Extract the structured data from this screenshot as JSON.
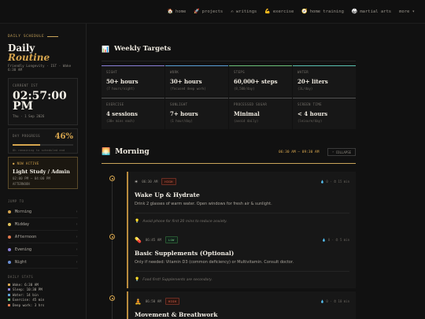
{
  "nav": {
    "items": [
      {
        "icon": "🏠",
        "icon_name": "home-icon",
        "label": "home"
      },
      {
        "icon": "🚀",
        "icon_name": "rocket-icon",
        "label": "projects"
      },
      {
        "icon": "✍",
        "icon_name": "writing-icon",
        "label": "writings"
      },
      {
        "icon": "💪",
        "icon_name": "muscle-icon",
        "label": "exercise"
      },
      {
        "icon": "🧭",
        "icon_name": "compass-icon",
        "label": "home training"
      },
      {
        "icon": "🥋",
        "icon_name": "martial-arts-icon",
        "label": "martial arts"
      }
    ],
    "more_label": "more ▾"
  },
  "sidebar": {
    "eyebrow": "DAILY SCHEDULE",
    "brand_line1": "Daily",
    "brand_line2": "Routine",
    "brand_sub": "Friendly Longevity · IST · Wake 6:30 AM",
    "clock": {
      "label": "CURRENT IST",
      "time_main": "02:57:00",
      "time_ampm": "PM",
      "date": "Thu · 1 Sep 2026"
    },
    "progress": {
      "label": "DAY PROGRESS",
      "percent_text": "46%",
      "percent": 46,
      "note": "8h remaining to scheduled end"
    },
    "now_active": {
      "tag": "● NOW ACTIVE",
      "title": "Light Study / Admin",
      "time": "02:00 PM — 04:00 PM",
      "sub": "AFTERNOON"
    },
    "jump_label": "JUMP TO",
    "jump_items": [
      {
        "label": "Morning",
        "color": "#d6a54e"
      },
      {
        "label": "Midday",
        "color": "#e0c25a"
      },
      {
        "label": "Afternoon",
        "color": "#e07a4f"
      },
      {
        "label": "Evening",
        "color": "#8a7fd6"
      },
      {
        "label": "Night",
        "color": "#6a8fd6"
      }
    ],
    "stats_label": "DAILY STATS",
    "stats": [
      {
        "text": "Wake: 6:30 AM",
        "color": "#d6a54e"
      },
      {
        "text": "Sleep: 10:30 PM",
        "color": "#8a7fd6"
      },
      {
        "text": "Water: 14 bin",
        "color": "#5aa0d6"
      },
      {
        "text": "Exercise: 45 min",
        "color": "#6bbf7a"
      },
      {
        "text": "Deep work: 3 hrs",
        "color": "#e07a4f"
      }
    ]
  },
  "weekly": {
    "icon": "📊",
    "icon_name": "chart-icon",
    "title": "Weekly Targets",
    "cells": [
      {
        "label": "SIGHT",
        "value": "50+ hours",
        "sub": "(7 hours/night)",
        "accent": "#8a7fd6"
      },
      {
        "label": "WORK",
        "value": "30+ hours",
        "sub": "(focused deep work)",
        "accent": "#5aa0d6"
      },
      {
        "label": "STEPS",
        "value": "60,000+ steps",
        "sub": "(8,500/day)",
        "accent": "#6bbf7a"
      },
      {
        "label": "WATER",
        "value": "20+ liters",
        "sub": "(3L/day)",
        "accent": "#5ac0b0"
      },
      {
        "label": "EXERCISE",
        "value": "4 sessions",
        "sub": "(30+ mins each)",
        "accent": "#555555"
      },
      {
        "label": "SUNLIGHT",
        "value": "7+ hours",
        "sub": "(1 hour/day)",
        "accent": "#555555"
      },
      {
        "label": "PROCESSED SUGAR",
        "value": "Minimal",
        "sub": "(avoid daily)",
        "accent": "#555555"
      },
      {
        "label": "SCREEN TIME",
        "value": "< 4 hours",
        "sub": "(leisure/day)",
        "accent": "#555555"
      }
    ]
  },
  "morning": {
    "icon": "🌅",
    "icon_name": "sunrise-icon",
    "title": "Morning",
    "range": "06:30 AM — 09:30 AM",
    "button_label": "⌃ COLLAPSE",
    "tasks": [
      {
        "icon": "☀",
        "icon_name": "sun-icon",
        "time": "06:30 AM",
        "badge": "HIGH",
        "priority": "high",
        "meta": "💧 0 · ⏱ 15 min",
        "title": "Wake Up & Hydrate",
        "desc": "Drink 2 glasses of warm water. Open windows for fresh air & sunlight.",
        "tip": "Avoid phone for first 20 mins to reduce anxiety."
      },
      {
        "icon": "💊",
        "icon_name": "pill-icon",
        "time": "06:45 AM",
        "badge": "LOW",
        "priority": "low",
        "meta": "💧 0 · ⏱ 5 min",
        "title": "Basic Supplements (Optional)",
        "desc": "Only if needed: Vitamin D3 (common deficiency) or Multivitamin. Consult doctor.",
        "tip": "Food first! Supplements are secondary."
      },
      {
        "icon": "🧘",
        "icon_name": "meditation-icon",
        "time": "06:50 AM",
        "badge": "HIGH",
        "priority": "high",
        "meta": "💧 0 · ⏱ 10 min",
        "title": "Movement & Breathwork",
        "desc": "",
        "tip": ""
      }
    ]
  }
}
